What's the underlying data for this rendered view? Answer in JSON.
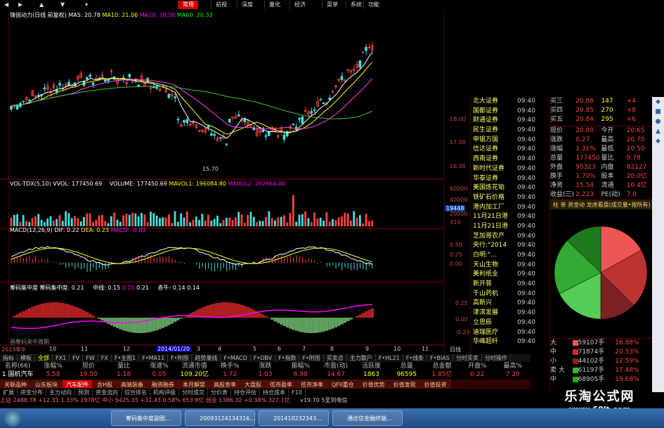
{
  "topbar": {
    "nav": [
      "常用",
      "前视",
      "深度",
      "量化",
      "经济",
      "菜单",
      "系统",
      "功能"
    ],
    "active": "常用"
  },
  "main_chart": {
    "title": "锋锐动力(日线 前复权)",
    "ma5": "MA5: 20.78",
    "ma10": "MA10: 21.06",
    "ma20": "MA20: 20.58",
    "ma60": "MA60: 20.33",
    "low_label": "15.70",
    "y_ticks": [
      "18.00",
      "17.00",
      "16.00"
    ]
  },
  "vol_panel": {
    "name": "VOL-TDX(5,10)",
    "vvol": "VVOL: 177450.69",
    "volume": "VOLUME: 177450.69",
    "mavol1": "MAVOL1: 196084.80",
    "mavol2": "MAVOL2: 292664.00",
    "ticks": [
      "60000",
      "40000",
      "20000",
      "X10"
    ],
    "current": "19448"
  },
  "macd_panel": {
    "name": "MACD(12,26,9)",
    "dif": "DIF: 0.22",
    "dea": "DEA: 0.23",
    "macd": "MACD: -0.03",
    "ticks": [
      "0.50",
      "0.25",
      "0.00"
    ]
  },
  "fund_panel": {
    "name": "筹码集中度",
    "label1": "筹码集中度: 0.21",
    "label2": "中线: 0.15",
    "label3": "0.15",
    "label4": "0.21",
    "label5": "赤牛: 0.14",
    "label6": "0.14",
    "ticks": [
      "0.25",
      "0.00",
      "-0.25"
    ],
    "footer": "画筹码来中周期"
  },
  "date_axis": {
    "left": "2013年9",
    "items": [
      "10",
      "11",
      "12",
      "2014/01/20",
      "3",
      "4",
      "5",
      "6",
      "7",
      "8",
      "9",
      "10",
      "11"
    ],
    "right": "日线"
  },
  "stock_list": [
    {
      "name": "北大证券",
      "time": "09:40"
    },
    {
      "name": "国都证券",
      "time": "09:40"
    },
    {
      "name": "财通证券",
      "time": "09:40"
    },
    {
      "name": "民生证券",
      "time": "09:40"
    },
    {
      "name": "申银万国",
      "time": "09:40"
    },
    {
      "name": "信达证券",
      "time": "09:40"
    },
    {
      "name": "西南证券",
      "time": "09:40"
    },
    {
      "name": "新时代证券",
      "time": "09:40"
    },
    {
      "name": "华泰证券",
      "time": "09:40"
    },
    {
      "name": "美国炼花铂",
      "time": "09:40"
    },
    {
      "name": "铁矿石价格",
      "time": "09:40"
    },
    {
      "name": "港内加工厂",
      "time": "09:40"
    },
    {
      "name": "11月21日港",
      "time": "09:40"
    },
    {
      "name": "11月21日港",
      "time": "09:40"
    },
    {
      "name": "芝加哥农产",
      "time": "09:40"
    },
    {
      "name": "央行:\"2014",
      "time": "09:40"
    },
    {
      "name": "白明:\"…",
      "time": "09:40"
    },
    {
      "name": "天山生物",
      "time": "09:40"
    },
    {
      "name": "美利纸业",
      "time": "09:40"
    },
    {
      "name": "新开普",
      "time": "09:40"
    },
    {
      "name": "千山药机",
      "time": "09:40"
    },
    {
      "name": "高新兴",
      "time": "09:40"
    },
    {
      "name": "津滨发展",
      "time": "09:40"
    },
    {
      "name": "立思辰",
      "time": "09:40"
    },
    {
      "name": "迪瑞医疗",
      "time": "09:40"
    },
    {
      "name": "华峰超纤",
      "time": "09:40"
    }
  ],
  "quote": {
    "bids": [
      {
        "l": "买三",
        "p": "20.86",
        "v": "147",
        "x": "+4"
      },
      {
        "l": "买四",
        "p": "20.85",
        "v": "270",
        "x": "+8"
      },
      {
        "l": "买五",
        "p": "20.84",
        "v": "295",
        "x": "+6"
      }
    ],
    "stats": [
      {
        "a": "现价",
        "b": "20.80",
        "c": "今开",
        "d": "20.65"
      },
      {
        "a": "涨跌",
        "b": "0.27",
        "c": "最高",
        "d": "20.70"
      },
      {
        "a": "涨幅",
        "b": "1.31%",
        "c": "最低",
        "d": "20.50"
      },
      {
        "a": "总量",
        "b": "177450",
        "c": "量比",
        "d": "0.78"
      },
      {
        "a": "外盘",
        "b": "95323",
        "c": "内盘",
        "d": "82127"
      },
      {
        "a": "换手",
        "b": "1.70%",
        "c": "股本",
        "d": "20.0亿"
      },
      {
        "a": "净资",
        "b": "15.54",
        "c": "流通",
        "d": "10.4亿"
      },
      {
        "a": "收益(三)",
        "b": "2.223",
        "c": "PE(动)",
        "d": "7.0"
      }
    ],
    "pie_title": "柱  单  资金动 龙虎看盘(成交量•按所有)",
    "pie_legend": [
      {
        "k": "大",
        "v": "59107手",
        "p": "16.88%",
        "color": "#e55"
      },
      {
        "k": "中",
        "v": "71874手",
        "p": "20.53%",
        "color": "#b33"
      },
      {
        "k": "小",
        "v": "44102手",
        "p": "12.59%",
        "color": "#822"
      },
      {
        "k": "卖 大",
        "v": "61197手",
        "p": "17.48%",
        "color": "#3b3"
      },
      {
        "k": "中",
        "v": "68905手",
        "p": "19.68%",
        "color": "#2a2"
      }
    ],
    "pie_values": [
      16.88,
      20.53,
      12.59,
      17.48,
      19.68,
      12.84
    ],
    "pie_colors": [
      "#ee5555",
      "#bb3333",
      "#7a2222",
      "#55cc55",
      "#33aa33",
      "#1f7a1f"
    ]
  },
  "bottom": {
    "tabs": [
      "指标",
      "模板",
      "全部",
      "FX1",
      "FV",
      "FW",
      "FX",
      "F•主图1",
      "F•MA11",
      "F•附图",
      "趋势量线",
      "F•MACD",
      "F•OBV",
      "F•指数",
      "F•附图",
      "买卖点",
      "主力散户",
      "F•HL21",
      "F•线条",
      "F•BIAS",
      "分时买卖",
      "分时操作"
    ],
    "headers": [
      "名称(66)",
      "涨幅%",
      "现价",
      "量比",
      "涨速%",
      "流通市值",
      "换手%",
      "涨跌",
      "振幅%",
      "市盈(动)",
      "活跃度",
      "总量",
      "总金额",
      "开盘%",
      "最高%"
    ],
    "row": [
      "1 国机汽车",
      "5.58",
      "19.50",
      "1.18",
      "0.05",
      "109.20亿",
      "1.72",
      "1.03",
      "6.98",
      "14.67",
      "1863",
      "96595",
      "1.85亿",
      "0.22",
      "7.20"
    ],
    "sectors": [
      "关联品种",
      "山东板块",
      "汽车配件",
      "含H股",
      "高端装备",
      "融资融券",
      "本月解禁",
      "高股息率",
      "大盘股",
      "低市盈率",
      "低市净率",
      "QFII重仓",
      "价值优势",
      "价值发现",
      "价值投资"
    ],
    "active_sector": "汽车配件",
    "status_tabs": [
      "扩展",
      "资金分布",
      "主力动向",
      "预测",
      "资金流向",
      "综合排名",
      "机构评级",
      "分时成交",
      "分价表",
      "持仓评估",
      "持仓成本",
      "F10"
    ],
    "status": "上证 2488.78 +12.31 1.33% 1978亿   中小 5425.35 +31.43 0.58% 653.8亿   创业 1386.32 +0.38% 327.1亿",
    "version": "v19.70 5至到电信"
  },
  "taskbar": {
    "buttons": [
      "筹码集中度副图...",
      "20093124134316...",
      "201410232343...",
      "通达信金融终端..."
    ]
  },
  "brand": {
    "title": "乐淘公式网",
    "url": "www.60lt.com"
  }
}
